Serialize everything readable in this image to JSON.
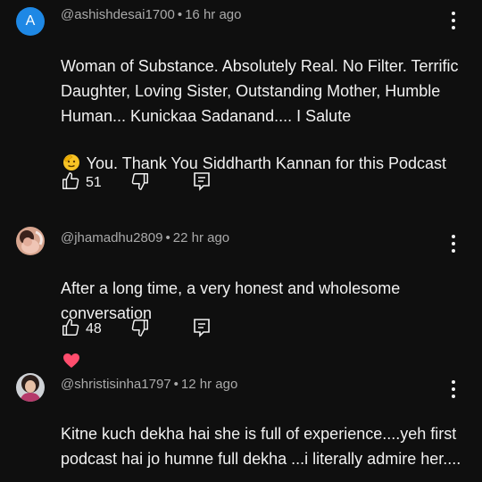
{
  "comments": [
    {
      "avatar_letter": "A",
      "avatar_color": "#1e88e5",
      "handle": "@ashishdesai1700",
      "time": "16 hr ago",
      "text_before_emoji": "Woman of Substance. Absolutely Real. No Filter. Terrific Daughter, Loving Sister, Outstanding Mother, Humble Human... Kunickaa Sadanand.... I Salute",
      "emoji": "saluting-face",
      "text_after_emoji": " You. Thank You Siddharth Kannan for this Podcast",
      "likes": "51"
    },
    {
      "avatar_letter": "",
      "handle": "@jhamadhu2809",
      "time": "22 hr ago",
      "text_before_emoji": "After a long time, a very honest and wholesome conversation",
      "emoji": "heart",
      "text_after_emoji": "",
      "likes": "48"
    },
    {
      "avatar_letter": "",
      "handle": "@shristisinha1797",
      "time": "12 hr ago",
      "text_before_emoji": "Kitne kuch dekha hai she is full of experience....yeh first podcast hai jo humne full dekha ...i literally admire her....",
      "emoji": "",
      "text_after_emoji": "",
      "likes": ""
    }
  ],
  "separator": "•"
}
